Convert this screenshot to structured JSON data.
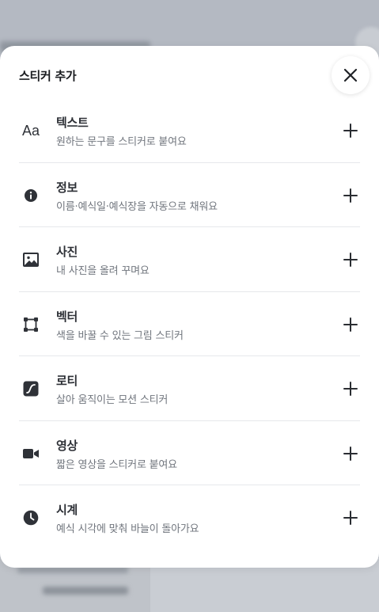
{
  "sheet": {
    "title": "스티커 추가",
    "close_icon": "close-icon"
  },
  "items": [
    {
      "id": "text",
      "icon": "text-aa-icon",
      "icon_text": "Aa",
      "title": "텍스트",
      "desc": "원하는 문구를 스티커로 붙여요"
    },
    {
      "id": "info",
      "icon": "info-icon",
      "title": "정보",
      "desc": "이름·예식일·예식장을 자동으로 채워요"
    },
    {
      "id": "photo",
      "icon": "image-icon",
      "title": "사진",
      "desc": "내 사진을 올려 꾸며요"
    },
    {
      "id": "vector",
      "icon": "vector-icon",
      "title": "벡터",
      "desc": "색을 바꿀 수 있는 그림 스티커"
    },
    {
      "id": "lottie",
      "icon": "lottie-icon",
      "title": "로티",
      "desc": "살아 움직이는 모션 스티커"
    },
    {
      "id": "video",
      "icon": "video-camera-icon",
      "title": "영상",
      "desc": "짧은 영상을 스티커로 붙여요"
    },
    {
      "id": "clock",
      "icon": "clock-icon",
      "title": "시계",
      "desc": "예식 시각에 맞춰 바늘이 돌아가요"
    }
  ],
  "colors": {
    "icon": "#2f3238",
    "title": "#2d3036",
    "desc": "#70757d",
    "divider": "#e6e8eb",
    "backdrop": "#b9bec6"
  }
}
